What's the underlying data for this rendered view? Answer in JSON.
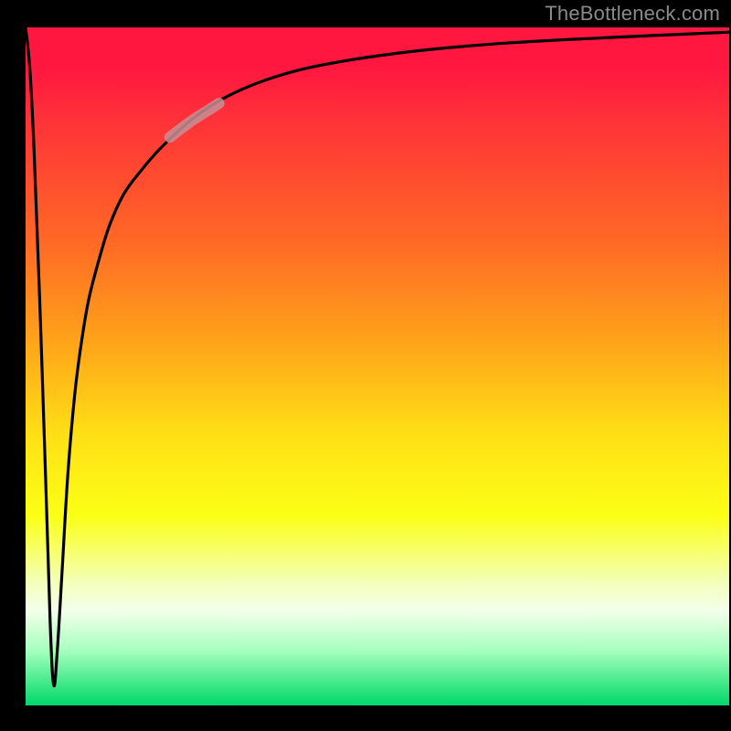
{
  "attribution": "TheBottleneck.com",
  "chart_data": {
    "type": "line",
    "title": "",
    "xlabel": "",
    "ylabel": "",
    "xlim": [
      0,
      100
    ],
    "ylim": [
      0,
      100
    ],
    "grid": false,
    "legend": false,
    "description": "Single black curve on a vertical red→green gradient background. The curve starts near the top-left, plunges to a sharp minimum near x≈4 reaching almost the bottom (best / near-zero area), then rises steeply and asymptotically flattens toward the top-right. A short pale highlight segment sits on the rising part of the curve around x≈21–27.",
    "series": [
      {
        "name": "curve",
        "x": [
          0.0,
          0.6,
          1.2,
          2.0,
          2.8,
          3.5,
          4.0,
          4.5,
          5.2,
          6.0,
          7.0,
          8.0,
          9.0,
          10.5,
          12.0,
          14.0,
          16.5,
          19.0,
          22.0,
          25.0,
          29.0,
          34.0,
          40.0,
          48.0,
          58.0,
          70.0,
          85.0,
          100.0
        ],
        "y": [
          100.0,
          94.0,
          82.0,
          60.0,
          35.0,
          12.0,
          3.0,
          8.0,
          20.0,
          34.0,
          46.0,
          54.0,
          60.0,
          66.0,
          71.0,
          75.5,
          79.0,
          82.0,
          85.0,
          87.5,
          90.0,
          92.2,
          94.0,
          95.5,
          96.8,
          97.8,
          98.6,
          99.3
        ]
      },
      {
        "name": "highlight-segment",
        "x": [
          20.5,
          22.0,
          24.0,
          26.0,
          27.5
        ],
        "y": [
          83.8,
          85.0,
          86.5,
          87.8,
          88.8
        ]
      }
    ],
    "colors": {
      "curve_stroke": "#000000",
      "highlight_stroke": "#c88f94",
      "gradient_top": "#ff1740",
      "gradient_bottom": "#00d86e"
    }
  }
}
